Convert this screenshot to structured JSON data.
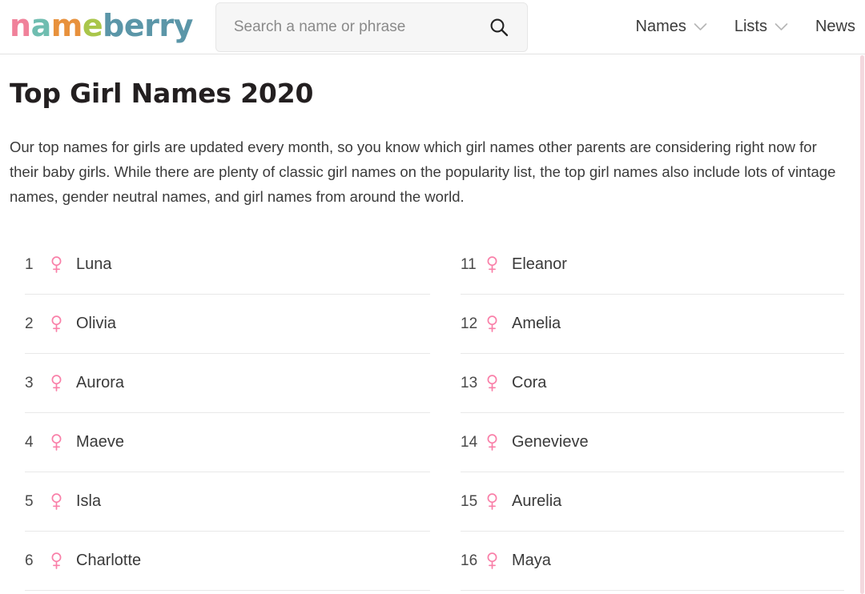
{
  "header": {
    "logo": {
      "text": "nameberry",
      "letters": [
        {
          "char": "n",
          "color": "#f0819a"
        },
        {
          "char": "a",
          "color": "#6fbdb0"
        },
        {
          "char": "m",
          "color": "#e8913c"
        },
        {
          "char": "e",
          "color": "#a9c64a"
        },
        {
          "char": "b",
          "color": "#5b96a8"
        },
        {
          "char": "e",
          "color": "#5b96a8"
        },
        {
          "char": "r",
          "color": "#5b96a8"
        },
        {
          "char": "r",
          "color": "#5b96a8"
        },
        {
          "char": "y",
          "color": "#5b96a8"
        }
      ]
    },
    "search": {
      "placeholder": "Search a name or phrase",
      "value": "",
      "icon": "search-icon",
      "button_label": "Search"
    },
    "nav": [
      {
        "label": "Names",
        "has_caret": true
      },
      {
        "label": "Lists",
        "has_caret": true
      },
      {
        "label": "News",
        "has_caret": false
      }
    ]
  },
  "main": {
    "title": "Top Girl Names 2020",
    "intro": "Our top names for girls are updated every month, so you know which girl names other parents are considering right now for their baby girls. While there are plenty of classic girl names on the popularity list, the top girl names also include lots of vintage names, gender neutral names, and girl names from around the world.",
    "gender_symbol": "♀",
    "gender_symbol_color": "#f97fa8",
    "columns": [
      {
        "column_name": "ranks-1-to-6",
        "items": [
          {
            "rank": "1",
            "name": "Luna",
            "gender": "female"
          },
          {
            "rank": "2",
            "name": "Olivia",
            "gender": "female"
          },
          {
            "rank": "3",
            "name": "Aurora",
            "gender": "female"
          },
          {
            "rank": "4",
            "name": "Maeve",
            "gender": "female"
          },
          {
            "rank": "5",
            "name": "Isla",
            "gender": "female"
          },
          {
            "rank": "6",
            "name": "Charlotte",
            "gender": "female"
          }
        ]
      },
      {
        "column_name": "ranks-11-to-16",
        "items": [
          {
            "rank": "11",
            "name": "Eleanor",
            "gender": "female"
          },
          {
            "rank": "12",
            "name": "Amelia",
            "gender": "female"
          },
          {
            "rank": "13",
            "name": "Cora",
            "gender": "female"
          },
          {
            "rank": "14",
            "name": "Genevieve",
            "gender": "female"
          },
          {
            "rank": "15",
            "name": "Aurelia",
            "gender": "female"
          },
          {
            "rank": "16",
            "name": "Maya",
            "gender": "female"
          }
        ]
      }
    ]
  },
  "theme": {
    "accent_pink": "#f97fa8",
    "scrollbar_thumb": "#f3d8de",
    "divider": "#e8e8e8",
    "text": "#3a3a3a",
    "title": "#231f20"
  }
}
